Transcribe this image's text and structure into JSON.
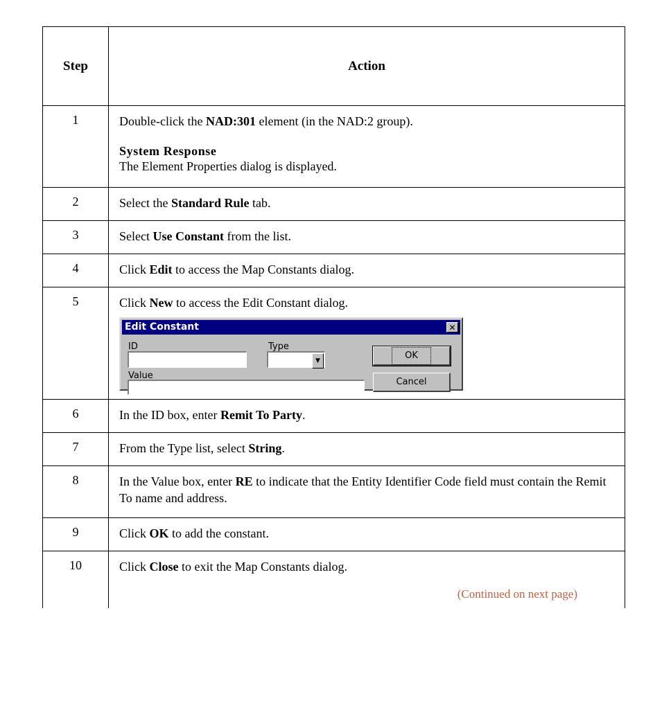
{
  "table": {
    "header": {
      "step": "Step",
      "action": "Action"
    },
    "rows": [
      {
        "step": "1",
        "a1": "Double-click the ",
        "b1": "NAD:301",
        "a2": " element (in the NAD:2 group)."
      },
      {
        "step": "2",
        "a1": "Select the ",
        "b1": "Standard Rule",
        "a2": " tab."
      },
      {
        "step": "3",
        "a1": "Select ",
        "b1": "Use Constant",
        "a2": " from the list."
      },
      {
        "step": "4",
        "a1": "Click ",
        "b1": "Edit",
        "a2": " to access the Map Constants dialog."
      },
      {
        "step": "5",
        "a1": "Click ",
        "b1": "New",
        "a2": " to access the Edit Constant dialog."
      },
      {
        "step": "6",
        "a1": "In the ID box, enter ",
        "b1": "Remit To Party",
        "a2": "."
      },
      {
        "step": "7",
        "a1": "From the Type list, select ",
        "b1": "String",
        "a2": "."
      },
      {
        "step": "8",
        "a1": "In the Value box, enter ",
        "b1": "RE",
        "a2": " to indicate that the Entity Identifier Code field must contain the Remit To name and address."
      },
      {
        "step": "9",
        "a1": "Click ",
        "b1": "OK",
        "a2": " to add the constant."
      },
      {
        "step": "10",
        "a1": "Click ",
        "b1": "Close",
        "a2": " to exit the Map Constants dialog."
      }
    ],
    "system_response": {
      "heading": "System Response",
      "text": "The Element Properties dialog is displayed."
    },
    "continued": "(Continued on next page)"
  },
  "dialog": {
    "title": "Edit Constant",
    "id_label": "ID",
    "id_value": "",
    "type_label": "Type",
    "type_value": "",
    "value_label": "Value",
    "value_value": "",
    "ok_label": "OK",
    "cancel_label": "Cancel"
  }
}
